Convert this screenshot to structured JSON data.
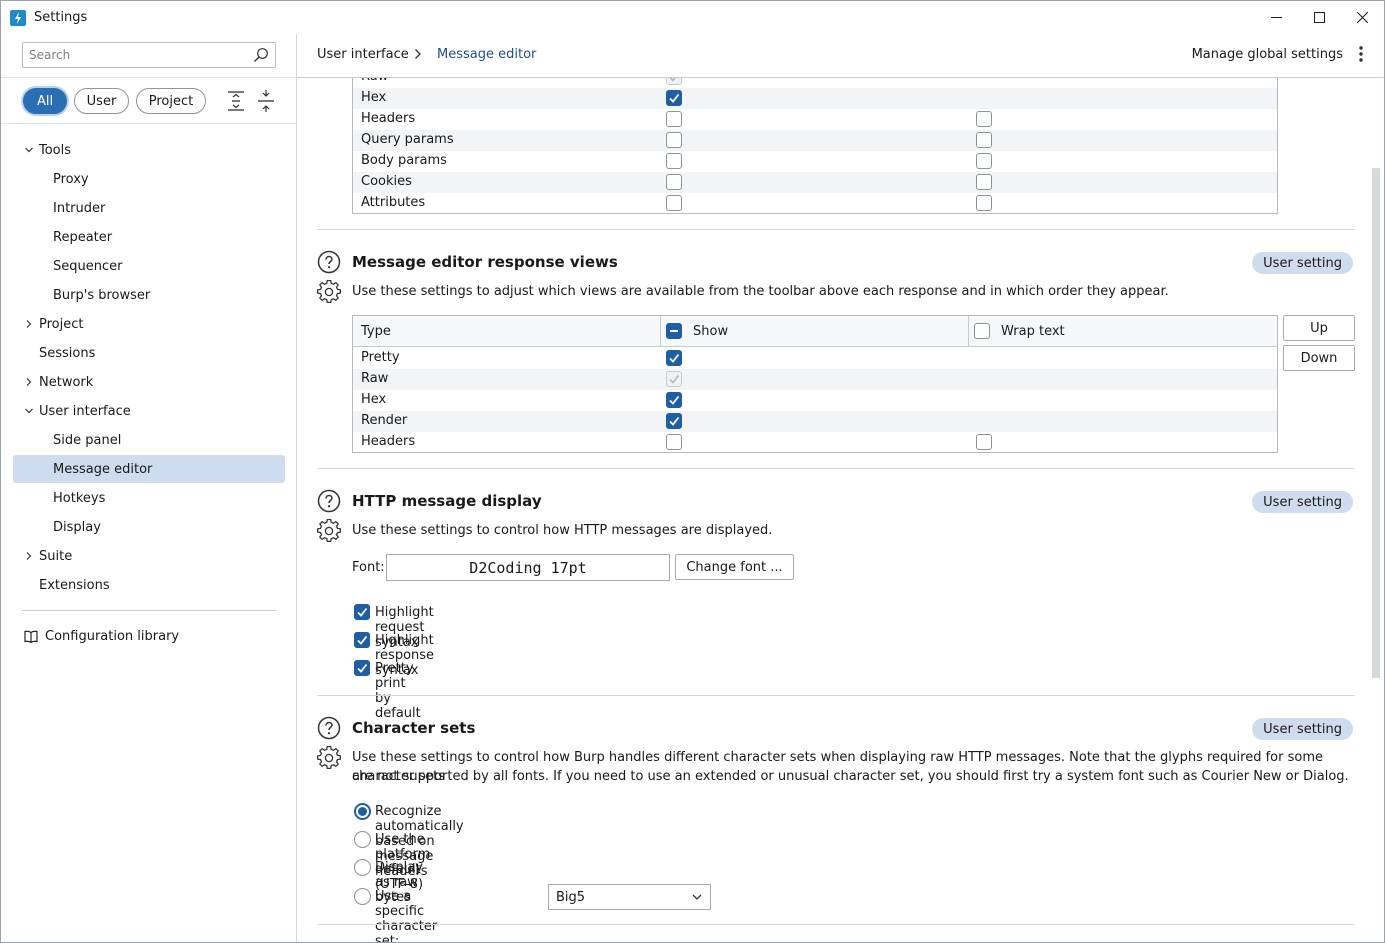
{
  "window": {
    "title": "Settings"
  },
  "sidebar": {
    "search_placeholder": "Search",
    "filters": [
      "All",
      "User",
      "Project"
    ],
    "active_filter": "All",
    "nav": [
      {
        "label": "Tools",
        "level": 0,
        "expanded": true
      },
      {
        "label": "Proxy",
        "level": 1
      },
      {
        "label": "Intruder",
        "level": 1
      },
      {
        "label": "Repeater",
        "level": 1
      },
      {
        "label": "Sequencer",
        "level": 1
      },
      {
        "label": "Burp's browser",
        "level": 1
      },
      {
        "label": "Project",
        "level": 0,
        "expanded": false
      },
      {
        "label": "Sessions",
        "level": 0
      },
      {
        "label": "Network",
        "level": 0,
        "expanded": false
      },
      {
        "label": "User interface",
        "level": 0,
        "expanded": true
      },
      {
        "label": "Side panel",
        "level": 1
      },
      {
        "label": "Message editor",
        "level": 1,
        "selected": true
      },
      {
        "label": "Hotkeys",
        "level": 1
      },
      {
        "label": "Display",
        "level": 1
      },
      {
        "label": "Suite",
        "level": 0,
        "expanded": false
      },
      {
        "label": "Extensions",
        "level": 0
      }
    ],
    "config_library": "Configuration library"
  },
  "header": {
    "breadcrumb": [
      "User interface",
      "Message editor"
    ],
    "manage": "Manage global settings"
  },
  "request_views_table": {
    "rows": [
      {
        "type": "Raw",
        "show": "disabled",
        "wrap": null
      },
      {
        "type": "Hex",
        "show": true,
        "wrap": null
      },
      {
        "type": "Headers",
        "show": false,
        "wrap": false
      },
      {
        "type": "Query params",
        "show": false,
        "wrap": false
      },
      {
        "type": "Body params",
        "show": false,
        "wrap": false
      },
      {
        "type": "Cookies",
        "show": false,
        "wrap": false
      },
      {
        "type": "Attributes",
        "show": false,
        "wrap": false
      }
    ]
  },
  "response_views": {
    "title": "Message editor response views",
    "badge": "User setting",
    "description": "Use these settings to adjust which views are available from the toolbar above each response and in which order they appear.",
    "columns": [
      "Type",
      "Show",
      "Wrap text"
    ],
    "rows": [
      {
        "type": "Pretty",
        "show": true,
        "wrap": null
      },
      {
        "type": "Raw",
        "show": "disabled",
        "wrap": null
      },
      {
        "type": "Hex",
        "show": true,
        "wrap": null
      },
      {
        "type": "Render",
        "show": true,
        "wrap": null
      },
      {
        "type": "Headers",
        "show": false,
        "wrap": false
      }
    ],
    "up_label": "Up",
    "down_label": "Down"
  },
  "http_display": {
    "title": "HTTP message display",
    "badge": "User setting",
    "description": "Use these settings to control how HTTP messages are displayed.",
    "font_label": "Font:",
    "font_value": "D2Coding 17pt",
    "change_font_label": "Change font ...",
    "options": [
      {
        "label": "Highlight request syntax",
        "checked": true
      },
      {
        "label": "Highlight response syntax",
        "checked": true
      },
      {
        "label": "Pretty print by default",
        "checked": true
      }
    ]
  },
  "charsets": {
    "title": "Character sets",
    "badge": "User setting",
    "description_line1": "Use these settings to control how Burp handles different character sets when displaying raw HTTP messages. Note that the glyphs required for some character sets",
    "description_line2": "are not supported by all fonts. If you need to use an extended or unusual character set, you should first try a system font such as Courier New or Dialog.",
    "options": [
      {
        "label": "Recognize automatically based on message headers",
        "selected": true
      },
      {
        "label": "Use the platform default (UTF-8)",
        "selected": false
      },
      {
        "label": "Display as raw bytes",
        "selected": false
      },
      {
        "label": "Use a specific character set:",
        "selected": false
      }
    ],
    "charset_value": "Big5"
  },
  "colors": {
    "accent": "#1e5fa3",
    "selected_bg": "#cddcef",
    "badge_bg": "#cddcef"
  }
}
